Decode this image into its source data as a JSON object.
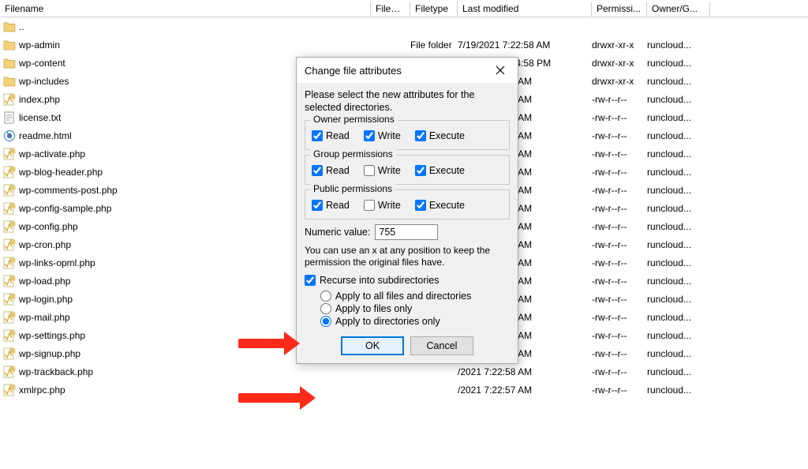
{
  "columns": {
    "filename": "Filename",
    "filesize": "Filesize",
    "filetype": "Filetype",
    "modified": "Last modified",
    "perms": "Permissi...",
    "owner": "Owner/G..."
  },
  "parent_row": {
    "name": ".."
  },
  "files": [
    {
      "icon": "folder",
      "name": "wp-admin",
      "filesize": "",
      "filetype": "File folder",
      "modified": "7/19/2021 7:22:58 AM",
      "perms": "drwxr-xr-x",
      "owner": "runcloud..."
    },
    {
      "icon": "folder",
      "name": "wp-content",
      "filesize": "",
      "filetype": "",
      "modified": "7/19/2021 1:24:58 PM",
      "perms": "drwxr-xr-x",
      "owner": "runcloud..."
    },
    {
      "icon": "folder",
      "name": "wp-includes",
      "filesize": "",
      "filetype": "",
      "modified": "/2021 7:22:58 AM",
      "perms": "drwxr-xr-x",
      "owner": "runcloud..."
    },
    {
      "icon": "php",
      "name": "index.php",
      "filesize": "",
      "filetype": "",
      "modified": "/2021 7:22:58 AM",
      "perms": "-rw-r--r--",
      "owner": "runcloud..."
    },
    {
      "icon": "txt",
      "name": "license.txt",
      "filesize": "",
      "filetype": "",
      "modified": "/2021 7:22:58 AM",
      "perms": "-rw-r--r--",
      "owner": "runcloud..."
    },
    {
      "icon": "html",
      "name": "readme.html",
      "filesize": "",
      "filetype": "",
      "modified": "/2021 7:22:58 AM",
      "perms": "-rw-r--r--",
      "owner": "runcloud..."
    },
    {
      "icon": "php",
      "name": "wp-activate.php",
      "filesize": "",
      "filetype": "",
      "modified": "/2021 7:22:57 AM",
      "perms": "-rw-r--r--",
      "owner": "runcloud..."
    },
    {
      "icon": "php",
      "name": "wp-blog-header.php",
      "filesize": "",
      "filetype": "",
      "modified": "/2021 7:22:58 AM",
      "perms": "-rw-r--r--",
      "owner": "runcloud..."
    },
    {
      "icon": "php",
      "name": "wp-comments-post.php",
      "filesize": "",
      "filetype": "",
      "modified": "/2021 7:22:58 AM",
      "perms": "-rw-r--r--",
      "owner": "runcloud..."
    },
    {
      "icon": "php",
      "name": "wp-config-sample.php",
      "filesize": "",
      "filetype": "",
      "modified": "/2021 7:22:57 AM",
      "perms": "-rw-r--r--",
      "owner": "runcloud..."
    },
    {
      "icon": "php",
      "name": "wp-config.php",
      "filesize": "",
      "filetype": "",
      "modified": "/2021 7:22:59 AM",
      "perms": "-rw-r--r--",
      "owner": "runcloud..."
    },
    {
      "icon": "php",
      "name": "wp-cron.php",
      "filesize": "",
      "filetype": "",
      "modified": "/2021 7:22:57 AM",
      "perms": "-rw-r--r--",
      "owner": "runcloud..."
    },
    {
      "icon": "php",
      "name": "wp-links-opml.php",
      "filesize": "",
      "filetype": "",
      "modified": "/2021 7:22:57 AM",
      "perms": "-rw-r--r--",
      "owner": "runcloud..."
    },
    {
      "icon": "php",
      "name": "wp-load.php",
      "filesize": "",
      "filetype": "",
      "modified": "/2021 7:22:58 AM",
      "perms": "-rw-r--r--",
      "owner": "runcloud..."
    },
    {
      "icon": "php",
      "name": "wp-login.php",
      "filesize": "",
      "filetype": "",
      "modified": "/2021 7:22:58 AM",
      "perms": "-rw-r--r--",
      "owner": "runcloud..."
    },
    {
      "icon": "php",
      "name": "wp-mail.php",
      "filesize": "",
      "filetype": "",
      "modified": "/2021 7:22:58 AM",
      "perms": "-rw-r--r--",
      "owner": "runcloud..."
    },
    {
      "icon": "php",
      "name": "wp-settings.php",
      "filesize": "",
      "filetype": "",
      "modified": "/2021 7:22:57 AM",
      "perms": "-rw-r--r--",
      "owner": "runcloud..."
    },
    {
      "icon": "php",
      "name": "wp-signup.php",
      "filesize": "",
      "filetype": "",
      "modified": "/2021 7:22:58 AM",
      "perms": "-rw-r--r--",
      "owner": "runcloud..."
    },
    {
      "icon": "php",
      "name": "wp-trackback.php",
      "filesize": "",
      "filetype": "",
      "modified": "/2021 7:22:58 AM",
      "perms": "-rw-r--r--",
      "owner": "runcloud..."
    },
    {
      "icon": "php",
      "name": "xmlrpc.php",
      "filesize": "",
      "filetype": "",
      "modified": "/2021 7:22:57 AM",
      "perms": "-rw-r--r--",
      "owner": "runcloud..."
    }
  ],
  "dialog": {
    "title": "Change file attributes",
    "instruction": "Please select the new attributes for the selected directories.",
    "groups": {
      "owner": {
        "label": "Owner permissions",
        "read": true,
        "write": true,
        "execute": true
      },
      "group": {
        "label": "Group permissions",
        "read": true,
        "write": false,
        "execute": true
      },
      "public": {
        "label": "Public permissions",
        "read": true,
        "write": false,
        "execute": true
      }
    },
    "perm_labels": {
      "read": "Read",
      "write": "Write",
      "execute": "Execute"
    },
    "numeric_label": "Numeric value:",
    "numeric_value": "755",
    "hint": "You can use an x at any position to keep the permission the original files have.",
    "recurse_label": "Recurse into subdirectories",
    "recurse_checked": true,
    "radios": {
      "all": "Apply to all files and directories",
      "files": "Apply to files only",
      "dirs": "Apply to directories only"
    },
    "radio_selected": "dirs",
    "ok_label": "OK",
    "cancel_label": "Cancel"
  }
}
